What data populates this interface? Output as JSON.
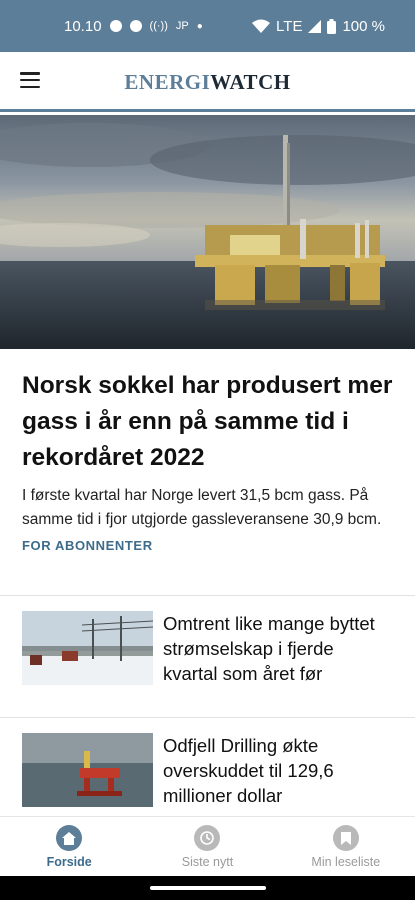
{
  "status_bar": {
    "time": "10.10",
    "carrier_tag": "JP",
    "network": "LTE",
    "battery": "100 %"
  },
  "app_bar": {
    "logo_part1": "ENERGI",
    "logo_part2": "WATCH"
  },
  "lead_article": {
    "title": "Norsk sokkel har produsert mer gass i år enn på samme tid i rekordåret 2022",
    "summary": "I første kvartal har Norge levert 31,5 bcm gass. På samme tid i fjor utgjorde gassleveransene 30,9 bcm.",
    "tag": "FOR ABONNENTER"
  },
  "stories": [
    {
      "title": "Omtrent like mange byttet strømselskap i fjerde kvartal som året før"
    },
    {
      "title": "Odfjell Drilling økte overskuddet til 129,6 millioner dollar"
    }
  ],
  "bottom_nav": [
    {
      "label": "Forside",
      "icon": "home-icon",
      "active": true
    },
    {
      "label": "Siste nytt",
      "icon": "clock-icon",
      "active": false
    },
    {
      "label": "Min leseliste",
      "icon": "bookmark-icon",
      "active": false
    }
  ],
  "colors": {
    "brand": "#5d7e98",
    "tag_blue": "#3c6b8c"
  }
}
